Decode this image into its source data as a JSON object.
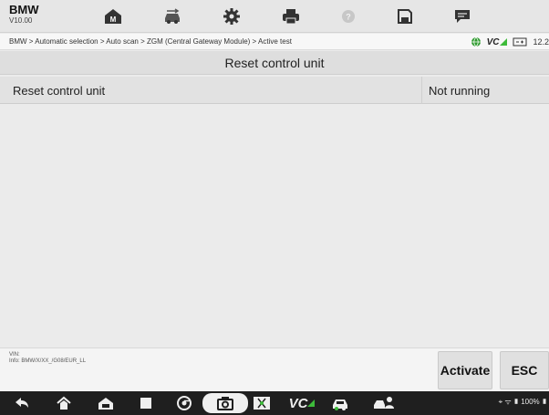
{
  "app": {
    "brand": "BMW",
    "version": "V10.00"
  },
  "toolbar": {
    "icons": [
      "home-icon",
      "vehicle-swap-icon",
      "gear-icon",
      "print-icon",
      "help-icon",
      "save-icon",
      "chat-icon"
    ]
  },
  "breadcrumb": "BMW > Automatic selection > Auto scan > ZGM (Central Gateway Module) > Active test",
  "status": {
    "vc_label": "VC",
    "battery_text": "12.2"
  },
  "page": {
    "title": "Reset control unit"
  },
  "table": {
    "rows": [
      {
        "name": "Reset control unit",
        "status": "Not running"
      }
    ]
  },
  "footer": {
    "vin_label": "VIN:",
    "info": "Info: BMW/X/XX_/G08/EUR_LL",
    "activate_label": "Activate",
    "esc_label": "ESC"
  },
  "navbar": {
    "vc_label": "VC",
    "status_text": "100%"
  },
  "colors": {
    "accent_green": "#3dbb3a",
    "toolbar_bg": "#e6e6e6",
    "nav_bg": "#1f1f1f"
  }
}
